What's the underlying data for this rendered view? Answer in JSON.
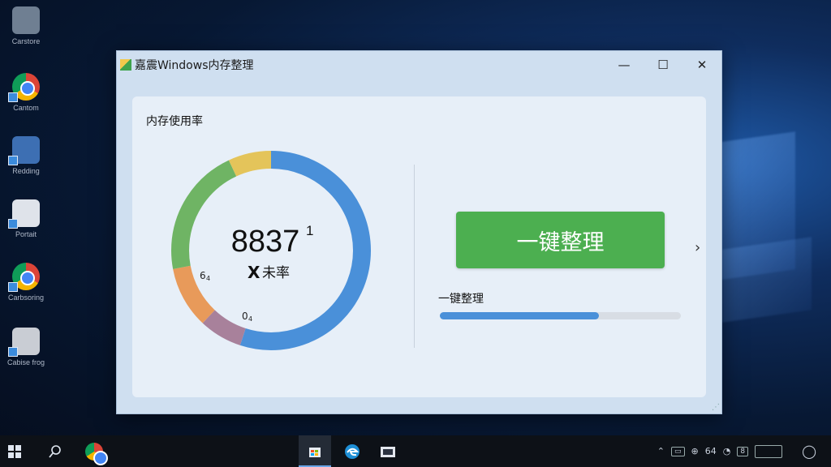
{
  "desktop": {
    "icons": [
      {
        "label": "Carstore",
        "icon": "store-icon"
      },
      {
        "label": "Cantom",
        "icon": "chrome-icon"
      },
      {
        "label": "Redding",
        "icon": "app-icon"
      },
      {
        "label": "Portait",
        "icon": "document-icon"
      },
      {
        "label": "Carbsoring",
        "icon": "chrome-icon"
      },
      {
        "label": "Cabise frog",
        "icon": "settings-icon"
      }
    ]
  },
  "window": {
    "title": "嘉震Windows内存整理",
    "controls": {
      "minimize": "—",
      "maximize": "☐",
      "close": "✕"
    }
  },
  "panel": {
    "section_title": "内存使用率",
    "gauge": {
      "value": "8837",
      "superscript": "1",
      "mark": "X",
      "label": "未率",
      "small_label_left": "6",
      "small_label_left_sub": "4",
      "small_label_bottom": "0",
      "small_label_bottom_sub": "4",
      "segments": [
        {
          "name": "blue",
          "color": "#4a90d9",
          "fraction": 0.55
        },
        {
          "name": "purple",
          "color": "#a8819b",
          "fraction": 0.07
        },
        {
          "name": "orange",
          "color": "#e89a5a",
          "fraction": 0.1
        },
        {
          "name": "green",
          "color": "#6fb464",
          "fraction": 0.21
        },
        {
          "name": "yellow",
          "color": "#e4c45a",
          "fraction": 0.07
        }
      ]
    },
    "clean_button": "一键整理",
    "progress_label": "一键整理",
    "progress": 0.66,
    "next_chevron": "›"
  },
  "taskbar": {
    "items": [
      "windows-start-icon",
      "search-icon",
      "chrome-icon",
      "store-icon",
      "edge-icon",
      "explorer-icon"
    ],
    "tray": {
      "b1": "64",
      "b2": "8"
    }
  }
}
